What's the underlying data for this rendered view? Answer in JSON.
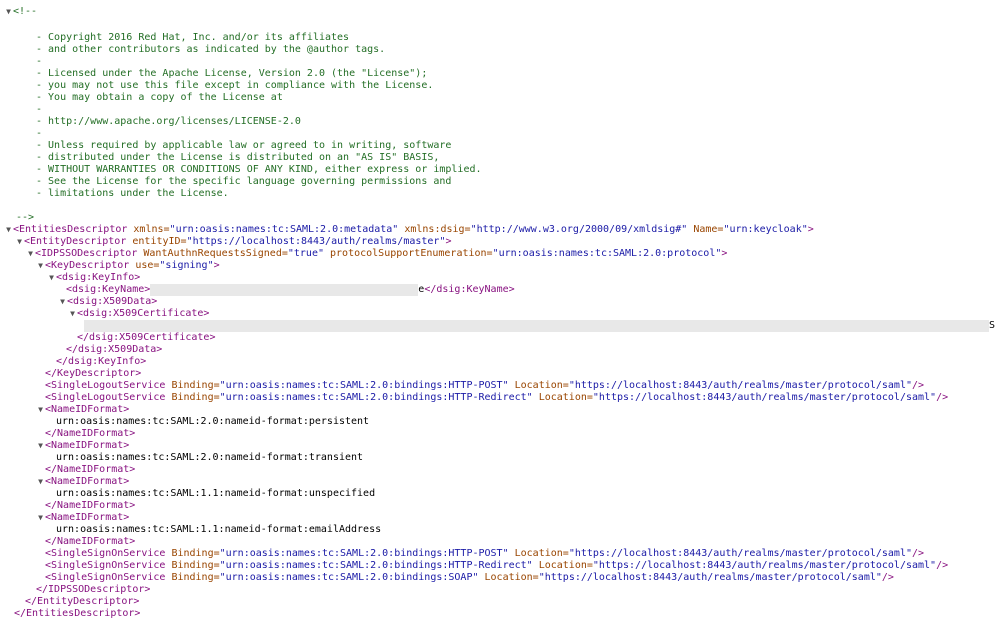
{
  "viewer": {
    "toggle_glyph": "▼",
    "comment": {
      "open": "<!--",
      "close": "-->",
      "lines": [
        "- Copyright 2016 Red Hat, Inc. and/or its affiliates",
        "- and other contributors as indicated by the @author tags.",
        "-",
        "- Licensed under the Apache License, Version 2.0 (the \"License\");",
        "- you may not use this file except in compliance with the License.",
        "- You may obtain a copy of the License at",
        "-",
        "- http://www.apache.org/licenses/LICENSE-2.0",
        "-",
        "- Unless required by applicable law or agreed to in writing, software",
        "- distributed under the License is distributed on an \"AS IS\" BASIS,",
        "- WITHOUT WARRANTIES OR CONDITIONS OF ANY KIND, either express or implied.",
        "- See the License for the specific language governing permissions and",
        "- limitations under the License."
      ]
    },
    "entities_descriptor": {
      "open": "<EntitiesDescriptor",
      "xmlns_attr": " xmlns=",
      "xmlns_val": "\"urn:oasis:names:tc:SAML:2.0:metadata\"",
      "dsig_attr": " xmlns:dsig=",
      "dsig_val": "\"http://www.w3.org/2000/09/xmldsig#\"",
      "name_attr": " Name=",
      "name_val": "\"urn:keycloak\"",
      "gt": ">",
      "close": "</EntitiesDescriptor>"
    },
    "entity_descriptor": {
      "open": "<EntityDescriptor",
      "id_attr": " entityID=",
      "id_val": "\"https://localhost:8443/auth/realms/master\"",
      "gt": ">",
      "close": "</EntityDescriptor>"
    },
    "idpsso": {
      "open": "<IDPSSODescriptor",
      "want_attr": " WantAuthnRequestsSigned=",
      "want_val": "\"true\"",
      "proto_attr": " protocolSupportEnumeration=",
      "proto_val": "\"urn:oasis:names:tc:SAML:2.0:protocol\"",
      "gt": ">",
      "close": "</IDPSSODescriptor>"
    },
    "key_descriptor": {
      "open": "<KeyDescriptor",
      "use_attr": " use=",
      "use_val": "\"signing\"",
      "gt": ">",
      "close": "</KeyDescriptor>"
    },
    "key_info": {
      "open": "<dsig:KeyInfo>",
      "close": "</dsig:KeyInfo>",
      "key_name_open": "<dsig:KeyName>",
      "key_name_tail": "e",
      "key_name_close": "</dsig:KeyName>"
    },
    "x509_data": {
      "open": "<dsig:X509Data>",
      "close": "</dsig:X509Data>",
      "cert_open": "<dsig:X509Certificate>",
      "cert_tail": "S",
      "cert_close": "</dsig:X509Certificate>"
    },
    "logout_services": [
      {
        "tag": "<SingleLogoutService",
        "binding_attr": " Binding=",
        "binding_val": "\"urn:oasis:names:tc:SAML:2.0:bindings:HTTP-POST\"",
        "loc_attr": " Location=",
        "loc_val": "\"https://localhost:8443/auth/realms/master/protocol/saml\"",
        "end": "/>"
      },
      {
        "tag": "<SingleLogoutService",
        "binding_attr": " Binding=",
        "binding_val": "\"urn:oasis:names:tc:SAML:2.0:bindings:HTTP-Redirect\"",
        "loc_attr": " Location=",
        "loc_val": "\"https://localhost:8443/auth/realms/master/protocol/saml\"",
        "end": "/>"
      }
    ],
    "nameid_formats": [
      {
        "open": "<NameIDFormat>",
        "value": "urn:oasis:names:tc:SAML:2.0:nameid-format:persistent",
        "close": "</NameIDFormat>"
      },
      {
        "open": "<NameIDFormat>",
        "value": "urn:oasis:names:tc:SAML:2.0:nameid-format:transient",
        "close": "</NameIDFormat>"
      },
      {
        "open": "<NameIDFormat>",
        "value": "urn:oasis:names:tc:SAML:1.1:nameid-format:unspecified",
        "close": "</NameIDFormat>"
      },
      {
        "open": "<NameIDFormat>",
        "value": "urn:oasis:names:tc:SAML:1.1:nameid-format:emailAddress",
        "close": "</NameIDFormat>"
      }
    ],
    "sso_services": [
      {
        "tag": "<SingleSignOnService",
        "binding_attr": " Binding=",
        "binding_val": "\"urn:oasis:names:tc:SAML:2.0:bindings:HTTP-POST\"",
        "loc_attr": " Location=",
        "loc_val": "\"https://localhost:8443/auth/realms/master/protocol/saml\"",
        "end": "/>"
      },
      {
        "tag": "<SingleSignOnService",
        "binding_attr": " Binding=",
        "binding_val": "\"urn:oasis:names:tc:SAML:2.0:bindings:HTTP-Redirect\"",
        "loc_attr": " Location=",
        "loc_val": "\"https://localhost:8443/auth/realms/master/protocol/saml\"",
        "end": "/>"
      },
      {
        "tag": "<SingleSignOnService",
        "binding_attr": " Binding=",
        "binding_val": "\"urn:oasis:names:tc:SAML:2.0:bindings:SOAP\"",
        "loc_attr": " Location=",
        "loc_val": "\"https://localhost:8443/auth/realms/master/protocol/saml\"",
        "end": "/>"
      }
    ]
  }
}
